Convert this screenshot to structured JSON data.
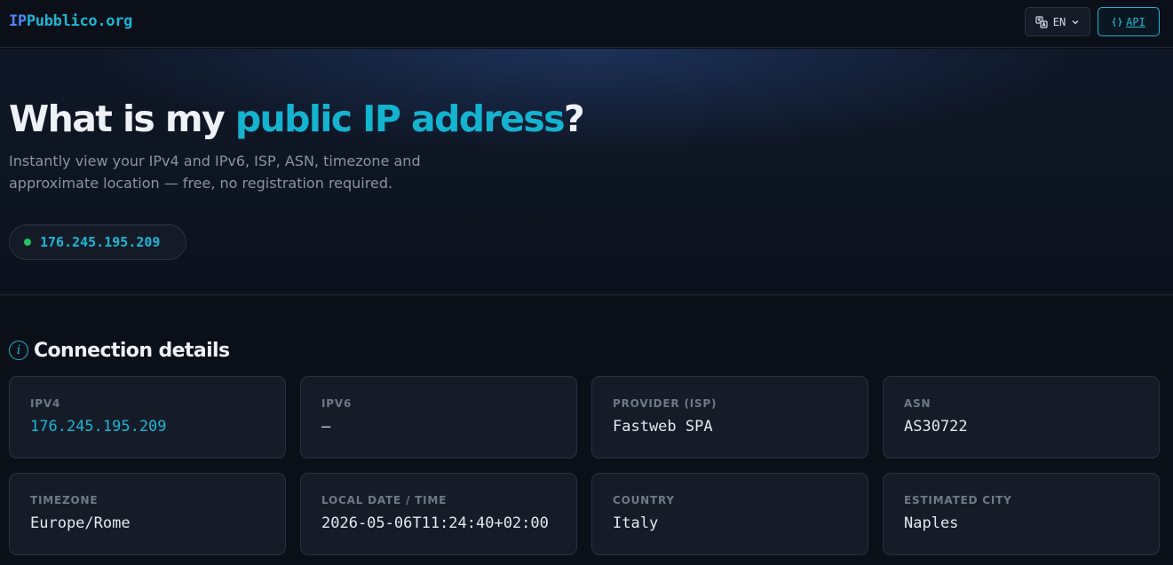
{
  "header": {
    "logo_part1": "IP",
    "logo_part2": "Pubblico.org",
    "lang_label": "EN",
    "api_label": "API"
  },
  "hero": {
    "title_part1": "What is my ",
    "title_highlight": "public IP address",
    "title_part2": "?",
    "subtitle": "Instantly view your IPv4 and IPv6, ISP, ASN, timezone and approximate location — free, no registration required.",
    "ip": "176.245.195.209"
  },
  "details": {
    "title": "Connection details",
    "cards": [
      {
        "label": "IPv4",
        "value": "176.245.195.209"
      },
      {
        "label": "IPv6",
        "value": "—"
      },
      {
        "label": "Provider (ISP)",
        "value": "Fastweb SPA"
      },
      {
        "label": "ASN",
        "value": "AS30722"
      },
      {
        "label": "Timezone",
        "value": "Europe/Rome"
      },
      {
        "label": "Local date / time",
        "value": "2026-05-06T11:24:40+02:00"
      },
      {
        "label": "Country",
        "value": "Italy"
      },
      {
        "label": "Estimated city",
        "value": "Naples"
      }
    ]
  },
  "colors": {
    "accent": "#19b6d6",
    "status_online": "#22c55e",
    "background": "#0b0f17"
  }
}
